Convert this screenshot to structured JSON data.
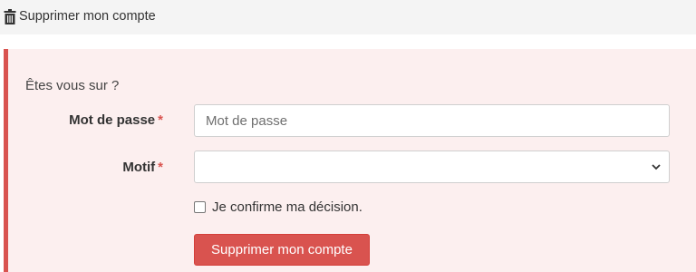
{
  "header": {
    "title": "Supprimer mon compte",
    "icon": "trash-icon"
  },
  "form": {
    "question": "Êtes vous sur ?",
    "password_label": "Mot de passe",
    "password_placeholder": "Mot de passe",
    "password_value": "",
    "motif_label": "Motif",
    "motif_value": "",
    "required_mark": "*",
    "confirm_label": "Je confirme ma décision.",
    "confirm_checked": false,
    "submit_label": "Supprimer mon compte"
  },
  "colors": {
    "danger": "#d9534f",
    "panel_bg": "#fcefef",
    "header_bg": "#f4f4f4"
  }
}
